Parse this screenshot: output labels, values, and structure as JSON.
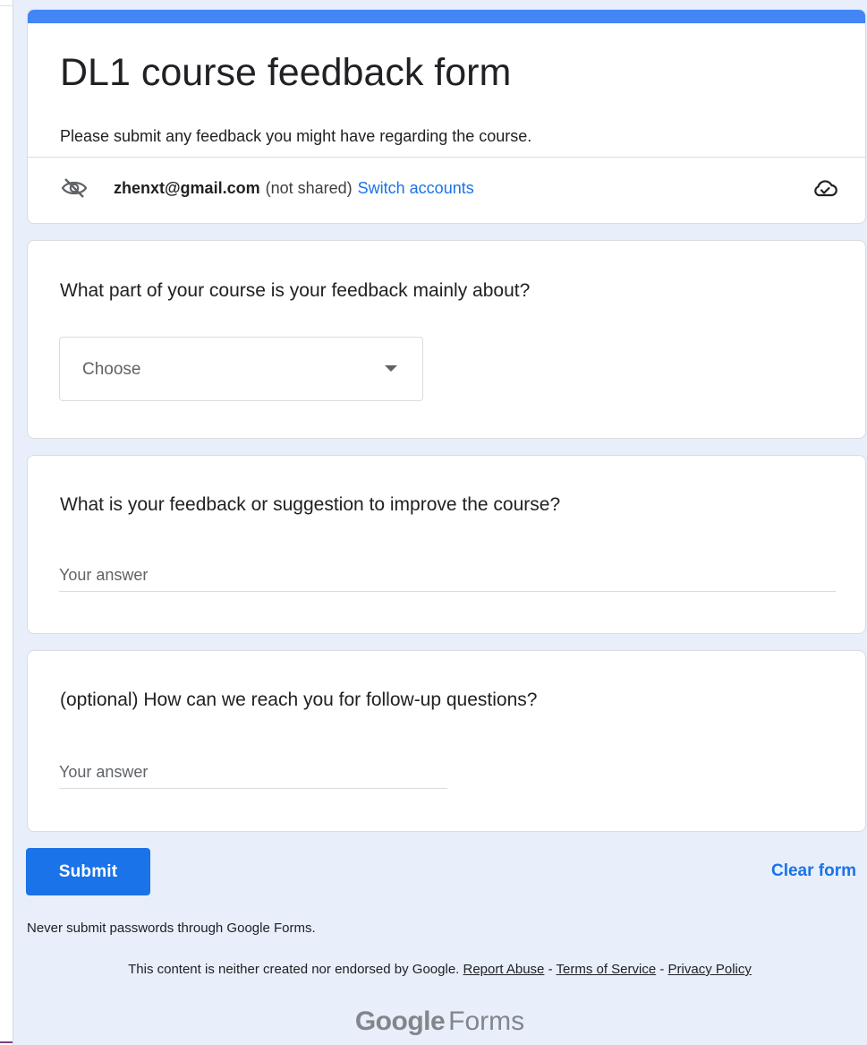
{
  "form": {
    "title": "DL1 course feedback form",
    "description": "Please submit any feedback you might have regarding the course.",
    "accent_color": "#4285f4",
    "background_color": "#e8effb"
  },
  "account": {
    "email": "zhenxt@gmail.com",
    "shared_status": "(not shared)",
    "switch_label": "Switch accounts",
    "privacy_icon": "eye-off-icon",
    "save_icon": "cloud-done-icon"
  },
  "questions": [
    {
      "title": "What part of your course is your feedback mainly about?",
      "type": "dropdown",
      "selected_label": "Choose"
    },
    {
      "title": "What is your feedback or suggestion to improve the course?",
      "type": "text",
      "placeholder": "Your answer"
    },
    {
      "title": "(optional) How can we reach you for follow-up questions?",
      "type": "text",
      "placeholder": "Your answer"
    }
  ],
  "actions": {
    "submit_label": "Submit",
    "clear_label": "Clear form",
    "primary_color": "#1a73e8"
  },
  "footer": {
    "password_warning": "Never submit passwords through Google Forms.",
    "disclaimer_text": "This content is neither created nor endorsed by Google.",
    "report_abuse": "Report Abuse",
    "separator": "-",
    "terms": "Terms of Service",
    "privacy": "Privacy Policy",
    "logo_brand": "Google",
    "logo_product": "Forms"
  }
}
